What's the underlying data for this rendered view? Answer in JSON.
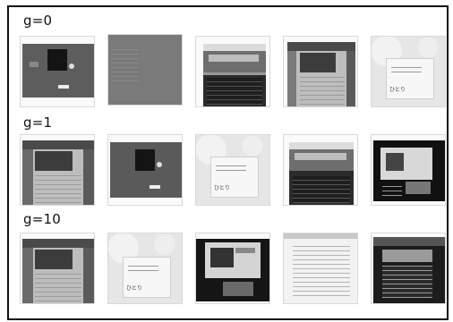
{
  "rows": [
    {
      "label": "g=0"
    },
    {
      "label": "g=1"
    },
    {
      "label": "g=10"
    }
  ],
  "thumb_text": {
    "shiba": "ひとり",
    "banner": "誰も持つ日本一周伝説"
  }
}
